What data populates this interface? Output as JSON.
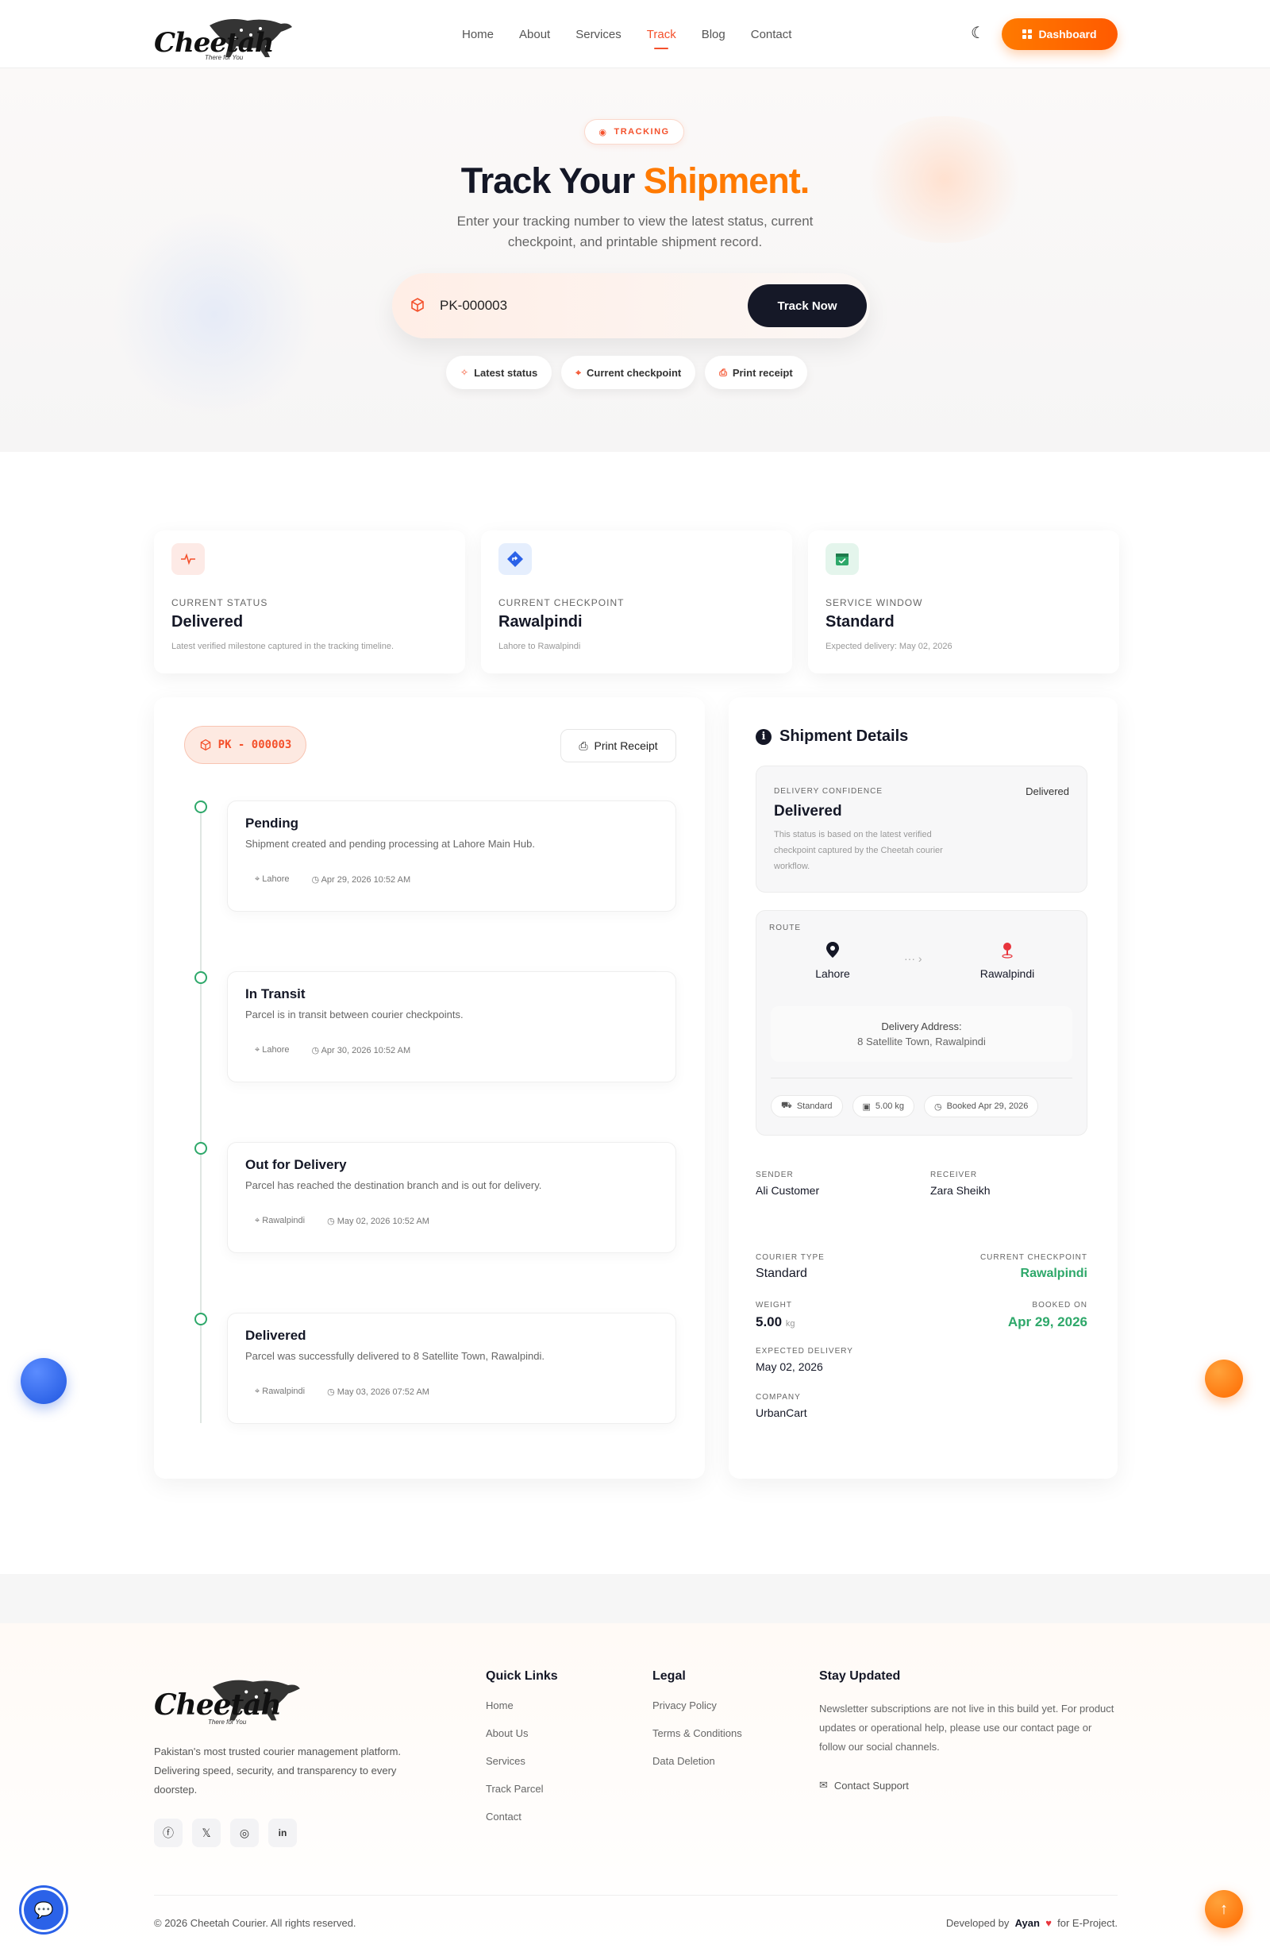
{
  "brand": {
    "name": "Cheetah",
    "tagline": "There for You"
  },
  "nav": {
    "links": [
      "Home",
      "About",
      "Services",
      "Track",
      "Blog",
      "Contact"
    ],
    "active": "Track",
    "dashboard_label": "Dashboard",
    "theme_icon": "moon-icon"
  },
  "hero": {
    "badge": "TRACKING",
    "title_main": "Track Your ",
    "title_accent": "Shipment",
    "title_dot": ".",
    "subtitle": "Enter your tracking number to view the latest status, current checkpoint, and printable shipment record.",
    "search_value": "PK-000003",
    "search_button": "Track Now",
    "chips": [
      "Latest status",
      "Current checkpoint",
      "Print receipt"
    ]
  },
  "stats": [
    {
      "label": "CURRENT STATUS",
      "value": "Delivered",
      "desc": "Latest verified milestone captured in the tracking timeline.",
      "icon": "pulse-icon"
    },
    {
      "label": "CURRENT CHECKPOINT",
      "value": "Rawalpindi",
      "desc": "Lahore to Rawalpindi",
      "icon": "route-icon"
    },
    {
      "label": "SERVICE WINDOW",
      "value": "Standard",
      "desc": "Expected delivery: May 02, 2026",
      "icon": "calendar-icon"
    }
  ],
  "timeline": {
    "code": "PK - 000003",
    "print_label": "Print Receipt",
    "events": [
      {
        "title": "Pending",
        "desc": "Shipment created and pending processing at Lahore Main Hub.",
        "location": "Lahore",
        "time": "Apr 29, 2026 10:52 AM"
      },
      {
        "title": "In Transit",
        "desc": "Parcel is in transit between courier checkpoints.",
        "location": "Lahore",
        "time": "Apr 30, 2026 10:52 AM"
      },
      {
        "title": "Out for Delivery",
        "desc": "Parcel has reached the destination branch and is out for delivery.",
        "location": "Rawalpindi",
        "time": "May 02, 2026 10:52 AM"
      },
      {
        "title": "Delivered",
        "desc": "Parcel was successfully delivered to 8 Satellite Town, Rawalpindi.",
        "location": "Rawalpindi",
        "time": "May 03, 2026 07:52 AM"
      }
    ]
  },
  "details": {
    "title": "Shipment Details",
    "confidence": {
      "label": "DELIVERY CONFIDENCE",
      "badge": "Delivered",
      "value": "Delivered",
      "desc": "This status is based on the latest verified checkpoint captured by the Cheetah courier workflow."
    },
    "route": {
      "label": "ROUTE",
      "from": "Lahore",
      "to": "Rawalpindi",
      "address_label": "Delivery Address:",
      "address": "8 Satellite Town, Rawalpindi",
      "tags": [
        "Standard",
        "5.00 kg",
        "Booked Apr 29, 2026"
      ]
    },
    "sender_label": "SENDER",
    "sender": "Ali Customer",
    "receiver_label": "RECEIVER",
    "receiver": "Zara Sheikh",
    "courier_type_label": "COURIER TYPE",
    "courier_type": "Standard",
    "checkpoint_label": "CURRENT CHECKPOINT",
    "checkpoint": "Rawalpindi",
    "weight_label": "WEIGHT",
    "weight": "5.00",
    "weight_unit": "kg",
    "booked_label": "BOOKED ON",
    "booked": "Apr 29, 2026",
    "expected_label": "EXPECTED DELIVERY",
    "expected": "May 02, 2026",
    "company_label": "COMPANY",
    "company": "UrbanCart"
  },
  "footer": {
    "about": "Pakistan's most trusted courier management platform. Delivering speed, security, and transparency to every doorstep.",
    "quick_links_title": "Quick Links",
    "quick_links": [
      "Home",
      "About Us",
      "Services",
      "Track Parcel",
      "Contact"
    ],
    "legal_title": "Legal",
    "legal": [
      "Privacy Policy",
      "Terms & Conditions",
      "Data Deletion"
    ],
    "news_title": "Stay Updated",
    "news_text": "Newsletter subscriptions are not live in this build yet. For product updates or operational help, please use our contact page or follow our social channels.",
    "support_label": "Contact Support",
    "copyright": "© 2026 Cheetah Courier. All rights reserved.",
    "dev_prefix": "Developed by",
    "dev_name": "Ayan",
    "dev_suffix": "for E-Project."
  },
  "colors": {
    "accent": "#ff7a00",
    "primary_red": "#f4512c",
    "dark": "#151827",
    "success": "#2ea86a",
    "fab_blue": "#2b62e8"
  }
}
